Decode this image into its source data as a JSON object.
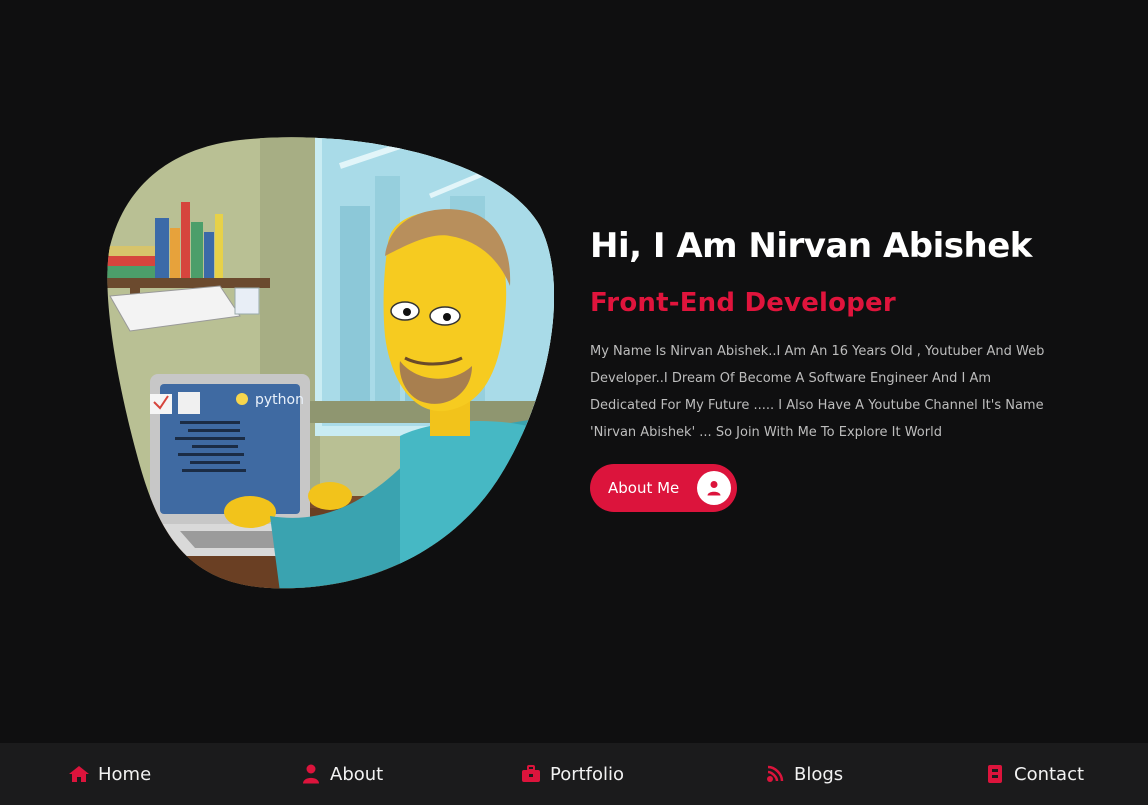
{
  "hero": {
    "title": "Hi, I Am Nirvan Abishek",
    "subtitle": "Front-End Developer",
    "description": "My Name Is Nirvan Abishek..I Am An 16 Years Old , Youtuber And Web Developer..I Dream Of Become A Software Engineer And I Am Dedicated For My Future ..... I Also Have A Youtube Channel It's Name 'Nirvan Abishek' ... So Join With Me To Explore It World",
    "button_label": "About Me",
    "button_icon": "user-icon",
    "illustration": {
      "laptop_logo_text": "python"
    }
  },
  "nav": {
    "items": [
      {
        "label": "Home",
        "icon": "home-icon"
      },
      {
        "label": "About",
        "icon": "user-icon"
      },
      {
        "label": "Portfolio",
        "icon": "briefcase-icon"
      },
      {
        "label": "Blogs",
        "icon": "blog-icon"
      },
      {
        "label": "Contact",
        "icon": "contact-book-icon"
      }
    ]
  },
  "colors": {
    "background": "#0f0f10",
    "nav_background": "#1b1b1c",
    "accent": "#dc143c",
    "text": "#ffffff",
    "muted_text": "#bdbdbd"
  }
}
